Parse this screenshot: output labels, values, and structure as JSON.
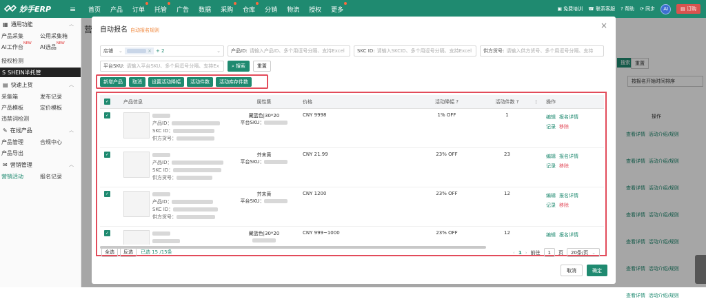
{
  "app": {
    "logo_text": "妙手ERP"
  },
  "nav": [
    "首页",
    "产品",
    "订单",
    "托管",
    "广告",
    "数据",
    "采购",
    "仓库",
    "分销",
    "物流",
    "授权",
    "更多"
  ],
  "nav_dots": [
    false,
    false,
    true,
    true,
    false,
    false,
    true,
    true,
    false,
    false,
    false,
    true
  ],
  "topright": {
    "training": "免费培训",
    "service": "联系客服",
    "help": "帮助",
    "sync": "同步",
    "avatar": "AI",
    "order": "订购"
  },
  "sidebar": {
    "section1": "通用功能",
    "rows1": [
      [
        "产品采集",
        "公用采集箱"
      ],
      [
        "AI工作台",
        "AI选品"
      ]
    ],
    "row_single": "授权检测",
    "shein": "SHEIN半托管",
    "section2": "快速上货",
    "rows2": [
      [
        "采集箱",
        "发布记录"
      ],
      [
        "产品模板",
        "定价模板"
      ],
      [
        "违禁词检测",
        ""
      ]
    ],
    "section3": "在线产品",
    "rows3": [
      [
        "产品管理",
        "合规中心"
      ],
      [
        "产品导出",
        ""
      ]
    ],
    "section4": "营销管理",
    "rows4": [
      [
        "营销活动",
        "报名记录"
      ]
    ]
  },
  "bg": {
    "partial_title": "营",
    "btn1": "搜索",
    "btn2": "重置",
    "sort": "按报名开始时间排序",
    "col": "操作",
    "link1": "查看详情",
    "link2": "活动介绍/规则"
  },
  "modal": {
    "title": "自动报名",
    "subtitle": "自动报名规则",
    "filters": {
      "store_label": "店铺",
      "store_tag_count": "+ 2",
      "product_id_label": "产品ID:",
      "product_id_ph": "请输入产品ID、多个用逗号分隔、支持Excel",
      "skc_label": "SKC ID:",
      "skc_ph": "请输入SKCID、多个用逗号分隔、支持Excel",
      "supplier_label": "供方货号:",
      "supplier_ph": "请输入供方货号、多个用逗号分隔、支持",
      "sku_label": "平台SKU:",
      "sku_ph": "请输入平台SKU、多个用逗号分隔、支持Ex",
      "search": "搜索",
      "reset": "重置"
    },
    "actions": [
      "新增产品",
      "取消",
      "设置活动降幅",
      "活动件数",
      "活动库存件数"
    ],
    "table": {
      "headers": [
        "产品信息",
        "属性集",
        "价格",
        "活动降幅",
        "活动件数",
        "操作"
      ],
      "rows": [
        {
          "labels": [
            "产品ID：",
            "SKC ID：",
            "供方货号："
          ],
          "attr1": "藏蓝色|30*20",
          "attr2": "平台SKU：",
          "price": "CNY 9998",
          "discount": "1% OFF",
          "count": "1",
          "ops": [
            "编辑",
            "报名详情",
            "记录",
            "移除"
          ]
        },
        {
          "labels": [
            "产品ID：",
            "SKC ID：",
            "供方货号："
          ],
          "attr1": "芥末黄",
          "attr2": "平台SKU：",
          "price": "CNY 21.99",
          "discount": "23% OFF",
          "count": "23",
          "ops": [
            "编辑",
            "报名详情",
            "记录",
            "移除"
          ]
        },
        {
          "labels": [
            "产品ID：",
            "SKC ID：",
            "供方货号："
          ],
          "attr1": "芥末黄",
          "attr2": "平台SKU：",
          "price": "CNY 1200",
          "discount": "23% OFF",
          "count": "12",
          "ops": [
            "编辑",
            "报名详情",
            "记录",
            "移除"
          ]
        },
        {
          "labels": [
            "",
            "",
            ""
          ],
          "attr1": "藏蓝色|30*20",
          "attr2": "",
          "price": "CNY 999~1000",
          "discount": "23% OFF",
          "count": "12",
          "ops": [
            "编辑",
            "报名详情",
            "",
            ""
          ]
        }
      ]
    },
    "footer": {
      "select_all": "全选",
      "invert": "反选",
      "selected": "已选 15 /15条",
      "page": "1",
      "goto": "前往",
      "page_input": "1",
      "page_unit": "页",
      "per_page": "20条/页"
    },
    "cancel": "取消",
    "ok": "确定"
  },
  "colors": {
    "accent": "#1f8a70",
    "highlight": "#e24b5a",
    "orange": "#f0883e"
  }
}
